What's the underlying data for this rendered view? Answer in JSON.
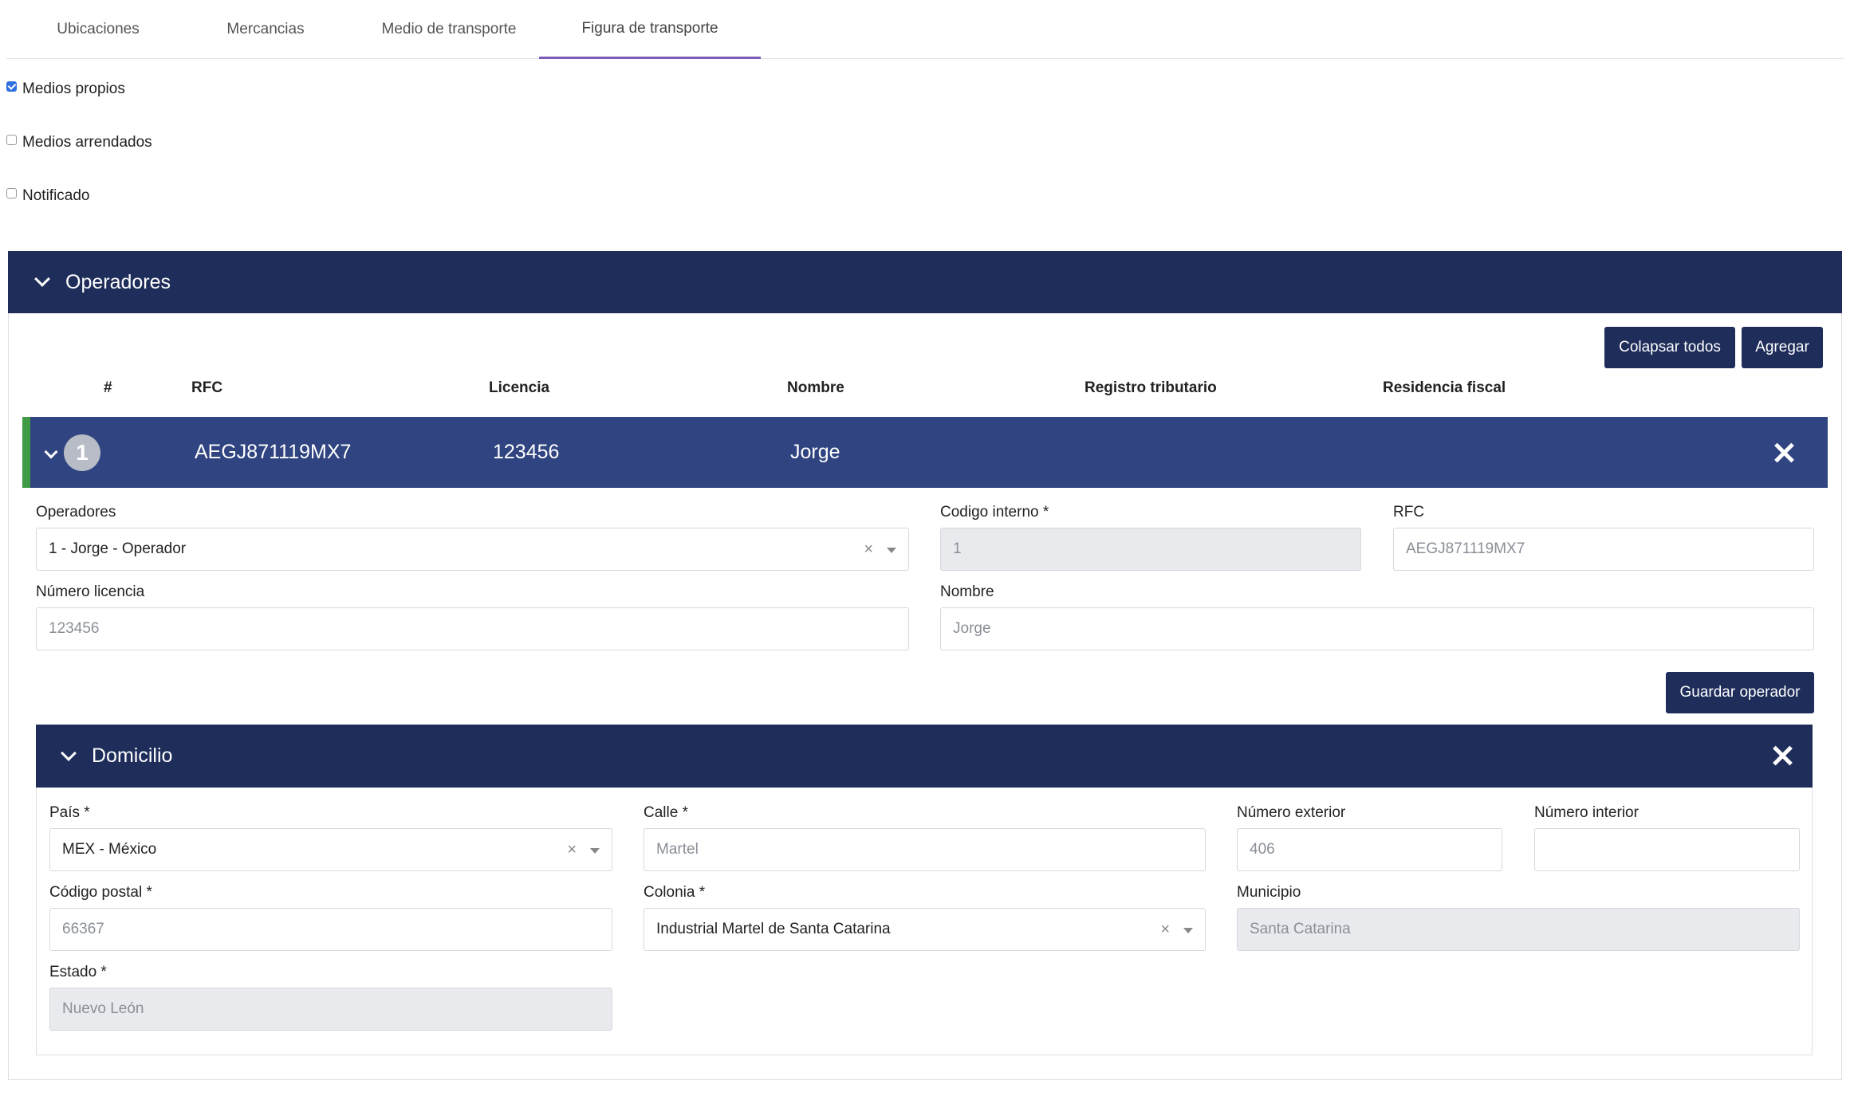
{
  "tabs": [
    {
      "label": "Ubicaciones",
      "active": false
    },
    {
      "label": "Mercancias",
      "active": false
    },
    {
      "label": "Medio de transporte",
      "active": false
    },
    {
      "label": "Figura de transporte",
      "active": true
    }
  ],
  "checks": [
    {
      "label": "Medios propios",
      "checked": true
    },
    {
      "label": "Medios arrendados",
      "checked": false
    },
    {
      "label": "Notificado",
      "checked": false
    }
  ],
  "operadores": {
    "title": "Operadores",
    "collapse_all_label": "Colapsar todos",
    "add_label": "Agregar",
    "columns": [
      "#",
      "RFC",
      "Licencia",
      "Nombre",
      "Registro tributario",
      "Residencia fiscal"
    ],
    "row": {
      "num": "1",
      "rfc": "AEGJ871119MX7",
      "licencia": "123456",
      "nombre": "Jorge"
    },
    "form": {
      "operadores_label": "Operadores",
      "operadores_value": "1 - Jorge - Operador",
      "codigo_label": "Codigo interno *",
      "codigo_value": "1",
      "rfc_label": "RFC",
      "rfc_value": "AEGJ871119MX7",
      "licencia_label": "Número licencia",
      "licencia_value": "123456",
      "nombre_label": "Nombre",
      "nombre_value": "Jorge",
      "save_label": "Guardar operador"
    }
  },
  "domicilio": {
    "title": "Domicilio",
    "pais_label": "País *",
    "pais_value": "MEX - México",
    "calle_label": "Calle *",
    "calle_value": "Martel",
    "num_ext_label": "Número exterior",
    "num_ext_value": "406",
    "num_int_label": "Número interior",
    "num_int_value": "",
    "cp_label": "Código postal *",
    "cp_value": "66367",
    "colonia_label": "Colonia *",
    "colonia_value": "Industrial Martel de Santa Catarina",
    "municipio_label": "Municipio",
    "municipio_value": "Santa Catarina",
    "estado_label": "Estado *",
    "estado_value": "Nuevo León"
  },
  "colors": {
    "header_navy": "#1f2d5a",
    "row_blue": "#2f4480",
    "accent_green": "#3f9b45",
    "tab_underline": "#7a5bb6"
  }
}
